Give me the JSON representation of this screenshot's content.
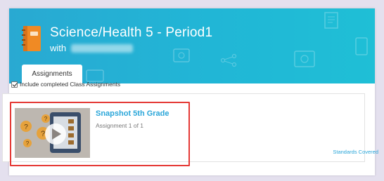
{
  "course": {
    "title": "Science/Health 5 - Period1",
    "with_label": "with"
  },
  "tabs": [
    {
      "label": "Assignments"
    }
  ],
  "filter": {
    "include_completed_label": "Include completed Class Assignments",
    "checked": true
  },
  "assignment": {
    "title": "Snapshot 5th Grade",
    "subtitle": "Assignment 1 of 1",
    "standards_link": "Standards Covered"
  },
  "colors": {
    "banner": "#21b6d6",
    "link": "#2aa6d9",
    "highlight": "#e53935",
    "book": "#f08a24"
  },
  "icons": {
    "course": "notebook-icon",
    "thumbnail": "video-play-icon"
  }
}
